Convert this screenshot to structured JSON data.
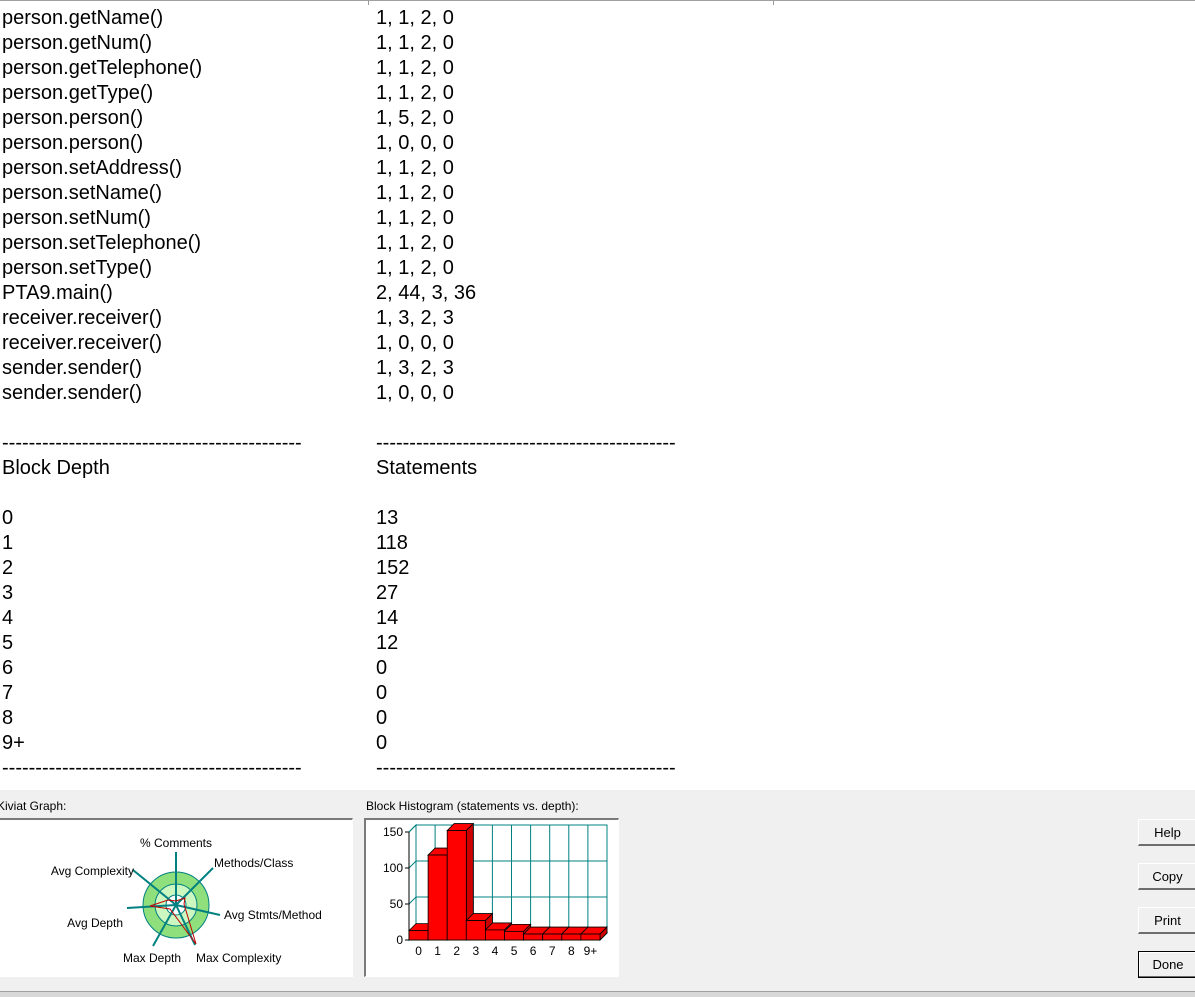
{
  "methods": [
    {
      "name": "person.getName()",
      "value": "1, 1, 2, 0"
    },
    {
      "name": "person.getNum()",
      "value": "1, 1, 2, 0"
    },
    {
      "name": "person.getTelephone()",
      "value": "1, 1, 2, 0"
    },
    {
      "name": "person.getType()",
      "value": "1, 1, 2, 0"
    },
    {
      "name": "person.person()",
      "value": "1, 5, 2, 0"
    },
    {
      "name": "person.person()",
      "value": "1, 0, 0, 0"
    },
    {
      "name": "person.setAddress()",
      "value": "1, 1, 2, 0"
    },
    {
      "name": "person.setName()",
      "value": "1, 1, 2, 0"
    },
    {
      "name": "person.setNum()",
      "value": "1, 1, 2, 0"
    },
    {
      "name": "person.setTelephone()",
      "value": "1, 1, 2, 0"
    },
    {
      "name": "person.setType()",
      "value": "1, 1, 2, 0"
    },
    {
      "name": "PTA9.main()",
      "value": "2, 44, 3, 36"
    },
    {
      "name": "receiver.receiver()",
      "value": "1, 3, 2, 3"
    },
    {
      "name": "receiver.receiver()",
      "value": "1, 0, 0, 0"
    },
    {
      "name": "sender.sender()",
      "value": "1, 3, 2, 3"
    },
    {
      "name": "sender.sender()",
      "value": "1, 0, 0, 0"
    }
  ],
  "separator": "---------------------------------------------",
  "block_table": {
    "col1_header": "Block Depth",
    "col2_header": "Statements",
    "rows": [
      {
        "depth": "0",
        "statements": "13"
      },
      {
        "depth": "1",
        "statements": "118"
      },
      {
        "depth": "2",
        "statements": "152"
      },
      {
        "depth": "3",
        "statements": "27"
      },
      {
        "depth": "4",
        "statements": "14"
      },
      {
        "depth": "5",
        "statements": "12"
      },
      {
        "depth": "6",
        "statements": "0"
      },
      {
        "depth": "7",
        "statements": "0"
      },
      {
        "depth": "8",
        "statements": "0"
      },
      {
        "depth": "9+",
        "statements": "0"
      }
    ]
  },
  "kiviat": {
    "label": "Kiviat Graph:",
    "axes": [
      "% Comments",
      "Methods/Class",
      "Avg Stmts/Method",
      "Max Complexity",
      "Max Depth",
      "Avg Depth",
      "Avg Complexity"
    ],
    "colors": {
      "outer_ring": "#8fe07d",
      "inner_ring": "#ccf7c1",
      "axis": "#008080",
      "plot": "#c00000"
    }
  },
  "histogram": {
    "label": "Block Histogram (statements vs. depth):",
    "chart_data": {
      "type": "bar",
      "categories": [
        "0",
        "1",
        "2",
        "3",
        "4",
        "5",
        "6",
        "7",
        "8",
        "9+"
      ],
      "values": [
        13,
        118,
        152,
        27,
        14,
        12,
        0,
        0,
        0,
        0
      ],
      "yticks": [
        "0",
        "50",
        "100",
        "150"
      ],
      "ylim": [
        0,
        150
      ],
      "grid": true,
      "colors": {
        "bar": "#ff0000",
        "grid": "#008080"
      }
    }
  },
  "buttons": {
    "help": "Help",
    "copy": "Copy",
    "print": "Print",
    "done": "Done"
  }
}
